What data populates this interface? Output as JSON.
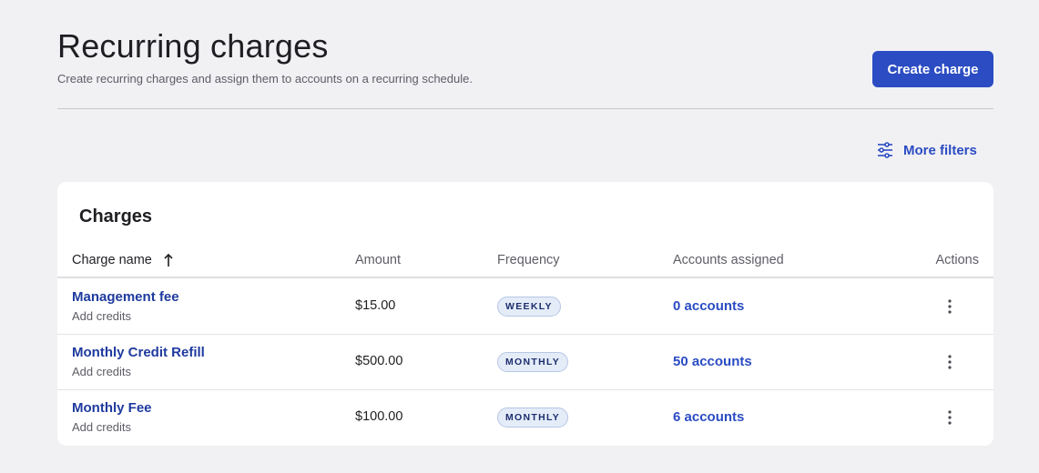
{
  "header": {
    "title": "Recurring charges",
    "subtitle": "Create recurring charges and assign them to accounts on a recurring schedule.",
    "create_label": "Create charge"
  },
  "filters": {
    "label": "More filters",
    "icon": "sliders-icon"
  },
  "table": {
    "title": "Charges",
    "columns": {
      "name": "Charge name",
      "amount": "Amount",
      "frequency": "Frequency",
      "accounts": "Accounts assigned",
      "actions": "Actions"
    },
    "sort_icon": "arrow-up-icon",
    "rows": [
      {
        "name": "Management fee",
        "type": "Add credits",
        "amount": "$15.00",
        "frequency": "WEEKLY",
        "accounts": "0 accounts"
      },
      {
        "name": "Monthly Credit Refill",
        "type": "Add credits",
        "amount": "$500.00",
        "frequency": "MONTHLY",
        "accounts": "50 accounts"
      },
      {
        "name": "Monthly Fee",
        "type": "Add credits",
        "amount": "$100.00",
        "frequency": "MONTHLY",
        "accounts": "6 accounts"
      }
    ],
    "row_action_icon": "kebab-menu-icon"
  },
  "colors": {
    "accent": "#2b4cc2",
    "link": "#1e3a9e",
    "background": "#f1f1f4"
  }
}
